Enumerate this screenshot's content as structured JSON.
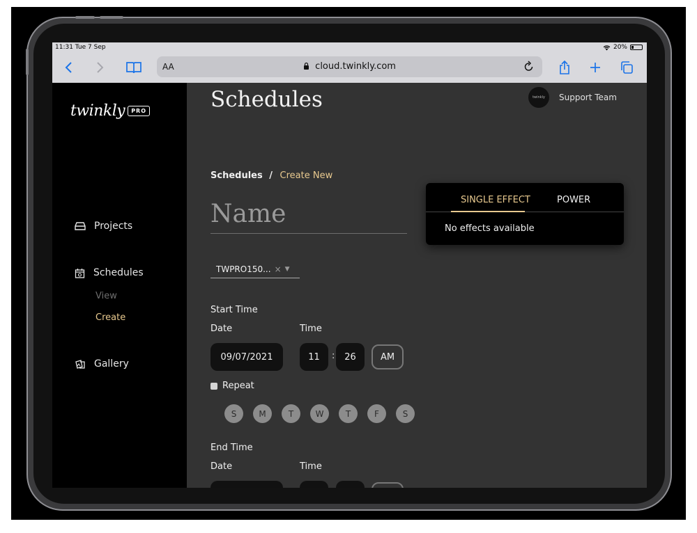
{
  "status_bar": {
    "time": "11:31  Tue 7 Sep",
    "battery": "20%"
  },
  "browser": {
    "text_size": "AA",
    "url": "cloud.twinkly.com"
  },
  "brand": {
    "logo_text": "twinkly",
    "badge": "PRO"
  },
  "sidebar": {
    "items": [
      {
        "label": "Projects"
      },
      {
        "label": "Schedules",
        "sub": [
          {
            "label": "View"
          },
          {
            "label": "Create"
          }
        ]
      },
      {
        "label": "Gallery"
      }
    ]
  },
  "header": {
    "title": "Schedules",
    "user_label": "Support Team",
    "avatar_text": "twinkly"
  },
  "breadcrumb": {
    "parent": "Schedules",
    "separator": "/",
    "current": "Create New"
  },
  "form": {
    "name_placeholder": "Name",
    "device": {
      "value": "TWPRO150...",
      "clear": "×",
      "caret": "▼"
    },
    "start": {
      "section": "Start Time",
      "date_label": "Date",
      "time_label": "Time",
      "date": "09/07/2021",
      "hour": "11",
      "sep": ":",
      "minute": "26",
      "ampm": "AM"
    },
    "repeat_label": "Repeat",
    "days": [
      "S",
      "M",
      "T",
      "W",
      "T",
      "F",
      "S"
    ],
    "end": {
      "section": "End Time",
      "date_label": "Date",
      "time_label": "Time"
    }
  },
  "effects_panel": {
    "tabs": [
      {
        "label": "SINGLE EFFECT",
        "active": true
      },
      {
        "label": "POWER",
        "active": false
      }
    ],
    "empty_message": "No effects available"
  },
  "colors": {
    "accent": "#e8c98f",
    "browser_blue": "#1a73e8",
    "sidebar_bg": "#000000",
    "main_bg": "#333333"
  }
}
